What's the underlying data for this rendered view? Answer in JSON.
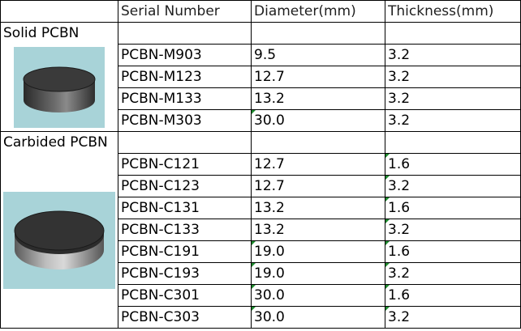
{
  "header": {
    "serial": "Serial Number",
    "diameter": "Diameter(mm)",
    "thickness": "Thickness(mm)"
  },
  "sections": [
    {
      "title": "Solid PCBN",
      "image": "solid-pcbn-blank-icon",
      "rows": [
        {
          "serial": "PCBN-M903",
          "diameter": "9.5",
          "thickness": "3.2"
        },
        {
          "serial": "PCBN-M123",
          "diameter": "12.7",
          "thickness": "3.2"
        },
        {
          "serial": "PCBN-M133",
          "diameter": "13.2",
          "thickness": "3.2"
        },
        {
          "serial": "PCBN-M303",
          "diameter": "30.0",
          "thickness": "3.2"
        }
      ]
    },
    {
      "title": "Carbided PCBN",
      "image": "carbided-pcbn-blank-icon",
      "rows": [
        {
          "serial": "PCBN-C121",
          "diameter": "12.7",
          "thickness": "1.6"
        },
        {
          "serial": "PCBN-C123",
          "diameter": "12.7",
          "thickness": "3.2"
        },
        {
          "serial": "PCBN-C131",
          "diameter": "13.2",
          "thickness": "1.6"
        },
        {
          "serial": "PCBN-C133",
          "diameter": "13.2",
          "thickness": "3.2"
        },
        {
          "serial": "PCBN-C191",
          "diameter": "19.0",
          "thickness": "1.6"
        },
        {
          "serial": "PCBN-C193",
          "diameter": "19.0",
          "thickness": "3.2"
        },
        {
          "serial": "PCBN-C301",
          "diameter": "30.0",
          "thickness": "1.6"
        },
        {
          "serial": "PCBN-C303",
          "diameter": "30.0",
          "thickness": "3.2"
        }
      ]
    }
  ],
  "colors": {
    "image_background": "#a8d3d8",
    "cell_marker": "#1e8a2e"
  }
}
